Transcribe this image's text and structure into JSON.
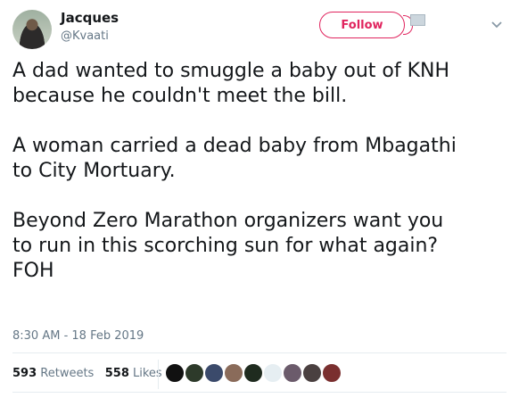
{
  "user": {
    "name": "Jacques",
    "handle": "@Kvaati"
  },
  "follow_label": "Follow",
  "tweet_text": "A dad wanted to smuggle a baby out of KNH\nbecause he couldn't meet the bill.\n\nA woman carried a dead baby from Mbagathi\nto City Mortuary.\n\nBeyond Zero Marathon organizers want you\nto run in this scorching sun for what again?\nFOH",
  "timestamp": "8:30 AM - 18 Feb 2019",
  "stats": {
    "retweets_count": "593",
    "retweets_label": "Retweets",
    "likes_count": "558",
    "likes_label": "Likes"
  },
  "liker_avatar_colors": [
    "#111111",
    "#2d3a2a",
    "#3b4a6b",
    "#8a6b5a",
    "#1f2b1f",
    "#e6eef2",
    "#6b5b6b",
    "#4a4040",
    "#7a2f2f"
  ],
  "colors": {
    "accent": "#e0245e",
    "secondary_text": "#657786"
  }
}
